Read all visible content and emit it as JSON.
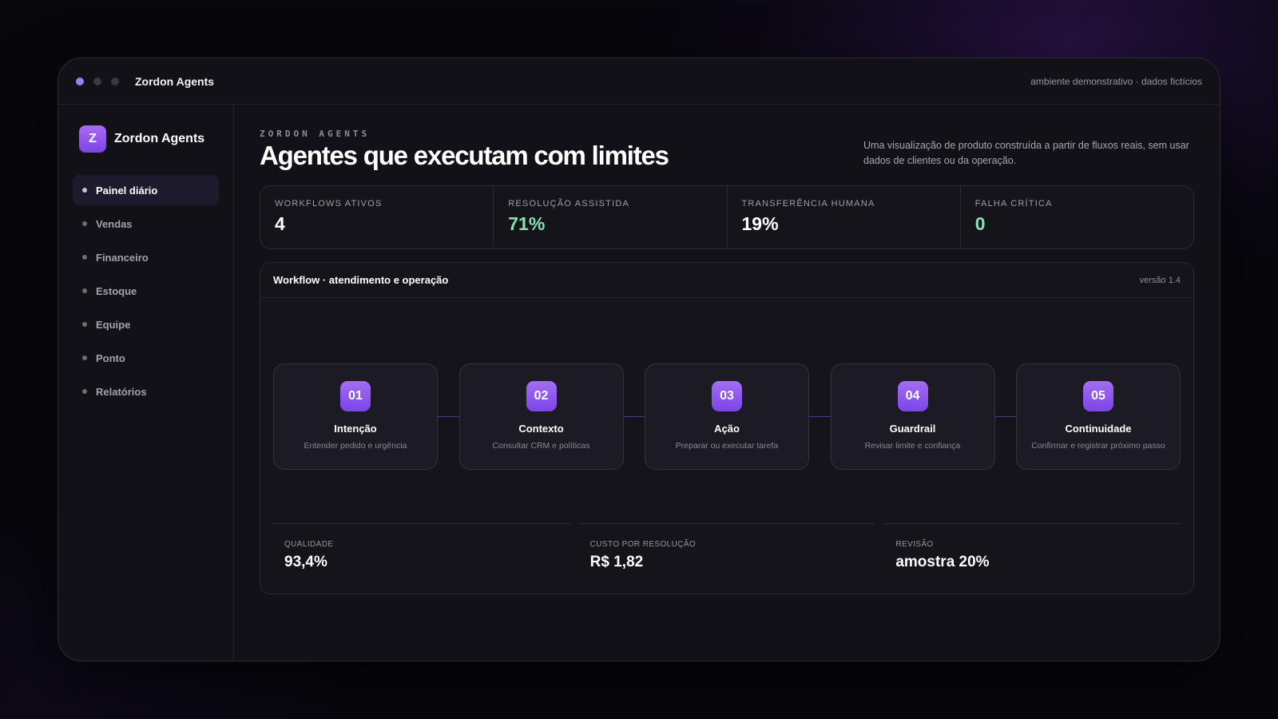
{
  "window": {
    "title": "Zordon Agents",
    "environment_note": "ambiente demonstrativo · dados fictícios"
  },
  "sidebar": {
    "brand_initial": "Z",
    "brand_name": "Zordon Agents",
    "items": [
      {
        "label": "Painel diário",
        "active": true
      },
      {
        "label": "Vendas",
        "active": false
      },
      {
        "label": "Financeiro",
        "active": false
      },
      {
        "label": "Estoque",
        "active": false
      },
      {
        "label": "Equipe",
        "active": false
      },
      {
        "label": "Ponto",
        "active": false
      },
      {
        "label": "Relatórios",
        "active": false
      }
    ]
  },
  "header": {
    "eyebrow": "ZORDON AGENTS",
    "title": "Agentes que executam com limites",
    "subtitle": "Uma visualização de produto construída a partir de fluxos reais, sem usar dados de clientes ou da operação."
  },
  "stats": [
    {
      "label": "WORKFLOWS ATIVOS",
      "value": "4"
    },
    {
      "label": "RESOLUÇÃO ASSISTIDA",
      "value": "71%"
    },
    {
      "label": "TRANSFERÊNCIA HUMANA",
      "value": "19%"
    },
    {
      "label": "FALHA CRÍTICA",
      "value": "0"
    }
  ],
  "workflow": {
    "title": "Workflow · atendimento e operação",
    "version": "versão 1.4",
    "steps": [
      {
        "num": "01",
        "title": "Intenção",
        "desc": "Entender pedido e urgência"
      },
      {
        "num": "02",
        "title": "Contexto",
        "desc": "Consultar CRM e políticas"
      },
      {
        "num": "03",
        "title": "Ação",
        "desc": "Preparar ou executar tarefa"
      },
      {
        "num": "04",
        "title": "Guardrail",
        "desc": "Revisar limite e confiança"
      },
      {
        "num": "05",
        "title": "Continuidade",
        "desc": "Confirmar e registrar próximo passo"
      }
    ],
    "metrics": [
      {
        "label": "QUALIDADE",
        "value": "93,4%"
      },
      {
        "label": "CUSTO POR RESOLUÇÃO",
        "value": "R$ 1,82"
      },
      {
        "label": "REVISÃO",
        "value": "amostra 20%"
      }
    ]
  },
  "colors": {
    "accent": "#8b55ee",
    "positive": "#86e3b0",
    "background": "#08070c",
    "panel": "#121118"
  }
}
